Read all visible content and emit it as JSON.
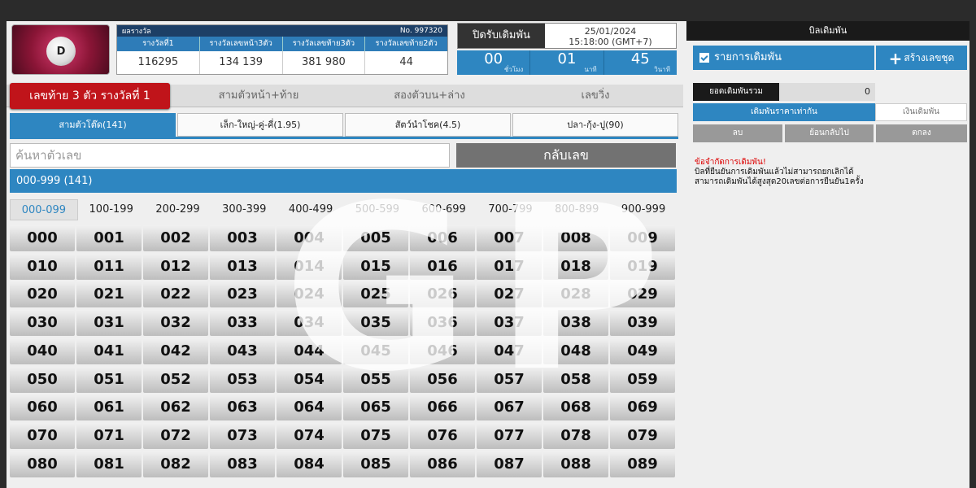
{
  "logo": {
    "letter": "D"
  },
  "results": {
    "title": "ผลรางวัล",
    "number_label": "No. 997320",
    "headers": [
      "รางวัลที่1",
      "รางวัลเลขหน้า3ตัว",
      "รางวัลเลขท้าย3ตัว",
      "รางวัลเลขท้าย2ตัว"
    ],
    "values": [
      "116295",
      "134   139",
      "381   980",
      "44"
    ]
  },
  "close": {
    "label": "ปิดรับเดิมพัน",
    "date": "25/01/2024",
    "time": "15:18:00 (GMT+7)"
  },
  "countdown": {
    "hours": "00",
    "hours_unit": "ชั่วโมง",
    "minutes": "01",
    "minutes_unit": "นาที",
    "seconds": "45",
    "seconds_unit": "วินาที"
  },
  "category_tabs": [
    "เลขท้าย 3 ตัว รางวัลที่ 1",
    "สามตัวหน้า+ท้าย",
    "สองตัวบน+ล่าง",
    "เลขวิ่ง"
  ],
  "sub_tabs": [
    "สามตัวโต๊ด(141)",
    "เล็ก-ใหญ่-คู่-คี่(1.95)",
    "สัตว์นำโชค(4.5)",
    "ปลา-กุ้ง-ปู(90)"
  ],
  "search": {
    "placeholder": "ค้นหาตัวเลข",
    "back_label": "กลับเลข"
  },
  "range_bar": "000-999 (141)",
  "ranges": [
    "000-099",
    "100-199",
    "200-299",
    "300-399",
    "400-499",
    "500-599",
    "600-699",
    "700-799",
    "800-899",
    "900-999"
  ],
  "numbers": [
    "000",
    "001",
    "002",
    "003",
    "004",
    "005",
    "006",
    "007",
    "008",
    "009",
    "010",
    "011",
    "012",
    "013",
    "014",
    "015",
    "016",
    "017",
    "018",
    "019",
    "020",
    "021",
    "022",
    "023",
    "024",
    "025",
    "026",
    "027",
    "028",
    "029",
    "030",
    "031",
    "032",
    "033",
    "034",
    "035",
    "036",
    "037",
    "038",
    "039",
    "040",
    "041",
    "042",
    "043",
    "044",
    "045",
    "046",
    "047",
    "048",
    "049",
    "050",
    "051",
    "052",
    "053",
    "054",
    "055",
    "056",
    "057",
    "058",
    "059",
    "060",
    "061",
    "062",
    "063",
    "064",
    "065",
    "066",
    "067",
    "068",
    "069",
    "070",
    "071",
    "072",
    "073",
    "074",
    "075",
    "076",
    "077",
    "078",
    "079",
    "080",
    "081",
    "082",
    "083",
    "084",
    "085",
    "086",
    "087",
    "088",
    "089"
  ],
  "watermark": "GPI",
  "panel": {
    "title": "บิลเดิมพัน",
    "list_label": "รายการเดิมพัน",
    "create_label": "สร้างเลขชุด",
    "total_label": "ยอดเดิมพันรวม",
    "total_value": "0",
    "mode_equal": "เดิมพันราคาเท่ากัน",
    "mode_money": "เงินเดิมพัน",
    "delete": "ลบ",
    "back": "ย้อนกลับไป",
    "ok": "ตกลง",
    "warn_title": "ข้อจำกัดการเดิมพัน!",
    "warn_line1": "บิลที่ยืนยันการเดิมพันแล้วไม่สามารถยกเลิกได้",
    "warn_line2": "สามารถเดิมพันได้สูงสุด20เลขต่อการยืนยัน1ครั้ง"
  }
}
